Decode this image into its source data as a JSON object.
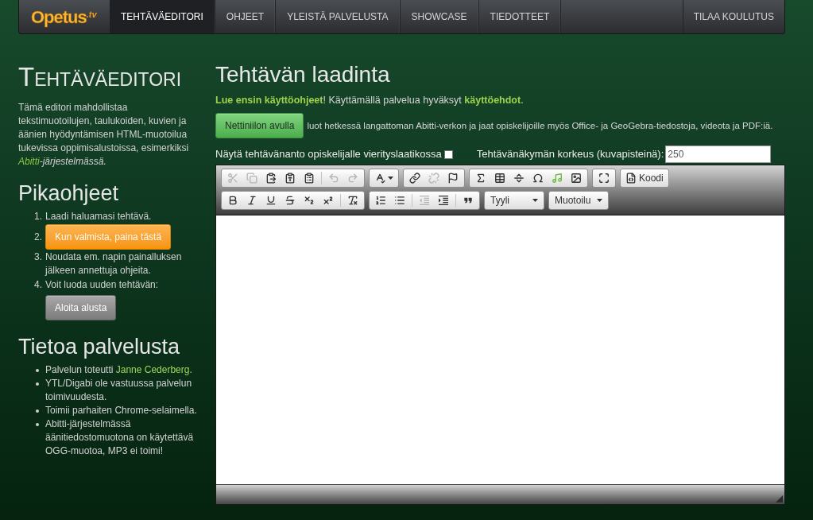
{
  "navbar": {
    "logo": {
      "text": "Opetus",
      "suffix": ".tv"
    },
    "items": [
      {
        "label": "TEHTÄVÄEDITORI",
        "selected": true
      },
      {
        "label": "OHJEET",
        "selected": false
      },
      {
        "label": "YLEISTÄ PALVELUSTA",
        "selected": false
      },
      {
        "label": "SHOWCASE",
        "selected": false
      },
      {
        "label": "TIEDOTTEET",
        "selected": false
      }
    ],
    "right_items": [
      {
        "label": "TILAA KOULUTUS",
        "selected": false
      }
    ]
  },
  "sidebar": {
    "title": "TEHTÄVÄEDITORI",
    "intro": {
      "text": "Tämä editori mahdollistaa tekstimuotoilujen, taulukoiden, kuvien ja äänien hyödyntämisen HTML-muotoilua tukevissa oppimisalustoissa, esimerkiksi",
      "link": "Abitti",
      "after": "-järjestelmässä."
    },
    "quick_guide": {
      "title": "Pikaohjeet",
      "steps": [
        {
          "number": "1.",
          "text": "Laadi haluamasi tehtävä."
        },
        {
          "number": "2.",
          "button": {
            "kind": "warning",
            "label": "Kun valmista, paina tästä"
          }
        },
        {
          "number": "3.",
          "text": "Noudata em. napin painalluksen jälkeen annettuja ohjeita."
        },
        {
          "number": "4.",
          "text": "Voit luoda uuden tehtävän:",
          "button": {
            "kind": "secondary",
            "label": "Aloita alusta"
          }
        }
      ]
    },
    "about": {
      "title": "Tietoa palvelusta",
      "items": [
        {
          "text": "Palvelun toteutti",
          "link": "Janne Cederberg."
        },
        {
          "text": "YTL/Digabi ole vastuussa palvelun toimivuudesta."
        },
        {
          "text": "Toimii parhaiten Chrome-selaimella."
        },
        {
          "text": "Abitti-järjestelmässä äänitiedostomuotona on käytettävä OGG-muotoa, MP3 ei toimi!"
        }
      ]
    }
  },
  "main": {
    "title": "Tehtävän laadinta",
    "notice": [
      {
        "kind": "link",
        "text": "Lue ensin käyttöohjeet"
      },
      {
        "kind": "text",
        "text": "! Käyttämällä palvelua hyväksyt "
      },
      {
        "kind": "link",
        "text": "käyttöehdot"
      },
      {
        "kind": "text",
        "text": "."
      }
    ],
    "promo": {
      "button": {
        "kind": "success",
        "label": "Nettiniilon avulla"
      },
      "text": "luot hetkessä langattoman Abitti-verkon ja jaat opiskelijoille myös Office- ja GeoGebra-tiedostoja, videota ja PDF:iä."
    },
    "options": {
      "scroll_box": {
        "label": "Näytä tehtävänanto opiskelijalle vierityslaatikossa",
        "checked": false
      },
      "height": {
        "label": "Tehtävänäkymän korkeus (kuvapisteinä):",
        "value": "250"
      }
    },
    "editor": {
      "toolbar": {
        "rows": [
          [
            {
              "kind": "buttons",
              "sections": [
                [
                  {
                    "kind": "cut",
                    "disabled": true
                  },
                  {
                    "kind": "copy",
                    "disabled": true
                  },
                  {
                    "kind": "paste",
                    "disabled": false
                  },
                  {
                    "kind": "pastetext",
                    "disabled": false
                  },
                  {
                    "kind": "pasteword",
                    "disabled": false
                  }
                ],
                [
                  {
                    "kind": "undo",
                    "disabled": true
                  },
                  {
                    "kind": "redo",
                    "disabled": true
                  }
                ]
              ]
            },
            {
              "kind": "buttons",
              "sections": [
                [
                  {
                    "kind": "spellcheck",
                    "disabled": false
                  }
                ]
              ]
            },
            {
              "kind": "buttons",
              "sections": [
                [
                  {
                    "kind": "link",
                    "disabled": false
                  },
                  {
                    "kind": "unlink",
                    "disabled": true
                  },
                  {
                    "kind": "anchor",
                    "disabled": false
                  }
                ]
              ]
            },
            {
              "kind": "buttons",
              "sections": [
                [
                  {
                    "kind": "formula",
                    "disabled": false
                  },
                  {
                    "kind": "table",
                    "disabled": false
                  },
                  {
                    "kind": "rule",
                    "disabled": false
                  },
                  {
                    "kind": "symbol",
                    "disabled": false
                  },
                  {
                    "kind": "audio",
                    "disabled": false
                  },
                  {
                    "kind": "image",
                    "disabled": false
                  }
                ]
              ]
            },
            {
              "kind": "buttons",
              "sections": [
                [
                  {
                    "kind": "maximize",
                    "disabled": false
                  }
                ]
              ]
            },
            {
              "kind": "buttons",
              "sections": [
                [
                  {
                    "kind": "source",
                    "label": "Koodi",
                    "disabled": false
                  }
                ]
              ]
            }
          ],
          [
            {
              "kind": "buttons",
              "sections": [
                [
                  {
                    "kind": "bold",
                    "disabled": false
                  },
                  {
                    "kind": "italic",
                    "disabled": false
                  },
                  {
                    "kind": "underline",
                    "disabled": false
                  },
                  {
                    "kind": "strike",
                    "disabled": false
                  },
                  {
                    "kind": "subscript",
                    "disabled": false
                  },
                  {
                    "kind": "superscript",
                    "disabled": false
                  }
                ],
                [
                  {
                    "kind": "clearformat",
                    "disabled": false
                  }
                ]
              ]
            },
            {
              "kind": "buttons",
              "sections": [
                [
                  {
                    "kind": "numbered",
                    "disabled": false
                  },
                  {
                    "kind": "bulleted",
                    "disabled": false
                  }
                ],
                [
                  {
                    "kind": "outdent",
                    "disabled": true
                  },
                  {
                    "kind": "indent",
                    "disabled": false
                  }
                ],
                [
                  {
                    "kind": "blockquote",
                    "disabled": false
                  }
                ]
              ]
            },
            {
              "kind": "combo",
              "label": "Tyyli"
            },
            {
              "kind": "combo",
              "label": "Muotoilu"
            }
          ]
        ]
      }
    }
  }
}
